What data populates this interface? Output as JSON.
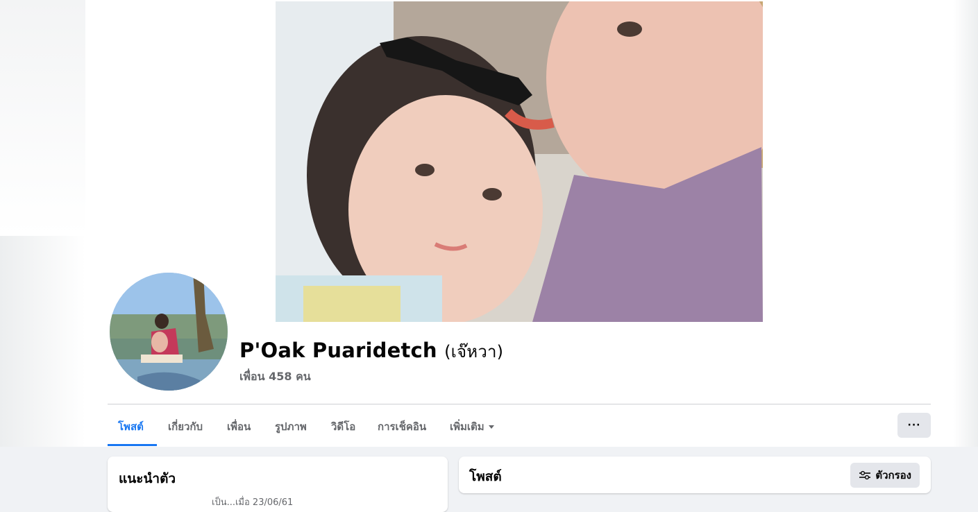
{
  "profile": {
    "name": "P'Oak Puaridetch",
    "nickname": "(เจ๊หวา)",
    "friends_label": "เพื่อน 458 คน"
  },
  "tabs": [
    {
      "label": "โพสต์",
      "active": true
    },
    {
      "label": "เกี่ยวกับ",
      "active": false
    },
    {
      "label": "เพื่อน",
      "active": false
    },
    {
      "label": "รูปภาพ",
      "active": false
    },
    {
      "label": "วิดีโอ",
      "active": false
    },
    {
      "label": "การเช็คอิน",
      "active": false
    },
    {
      "label": "เพิ่มเติม",
      "active": false
    }
  ],
  "more_button": {
    "label": "···",
    "icon": "ellipsis-icon"
  },
  "intro": {
    "title": "แนะนำตัว",
    "partial_line": "เป็น...เมื่อ 23/06/61"
  },
  "posts": {
    "title": "โพสต์",
    "filter_label": "ตัวกรอง",
    "filter_icon": "sliders-icon"
  },
  "colors": {
    "accent": "#1877f2",
    "page_bg": "#f0f2f5",
    "secondary_text": "#65676b"
  }
}
